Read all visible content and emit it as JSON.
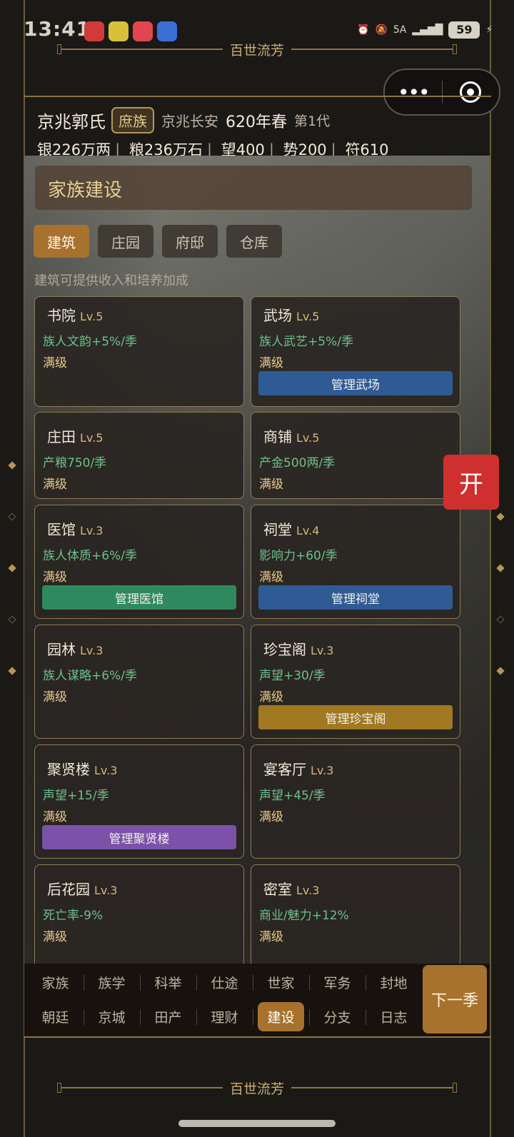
{
  "status_bar": {
    "time": "13:41",
    "network": "5A",
    "battery": "59"
  },
  "banner_text": "百世流芳",
  "capsule": {
    "menu_label": "•••"
  },
  "header": {
    "clan_name": "京兆郭氏",
    "clan_rank": "庶族",
    "location": "京兆长安",
    "year": "620年春",
    "generation": "第1代",
    "resources": [
      "银226万两",
      "粮236万石",
      "望400",
      "势200",
      "符610"
    ]
  },
  "section": {
    "title": "家族建设",
    "tabs": [
      "建筑",
      "庄园",
      "府邸",
      "仓库"
    ],
    "active_tab": "建筑",
    "hint": "建筑可提供收入和培养加成"
  },
  "buildings": [
    {
      "name": "书院",
      "level": "Lv.5",
      "effect": "族人文韵+5%/季",
      "status": "满级",
      "button": ""
    },
    {
      "name": "武场",
      "level": "Lv.5",
      "effect": "族人武艺+5%/季",
      "status": "满级",
      "button": "管理武场",
      "button_color": "#2f5b94"
    },
    {
      "name": "庄田",
      "level": "Lv.5",
      "effect": "产粮750/季",
      "status": "满级",
      "button": ""
    },
    {
      "name": "商铺",
      "level": "Lv.5",
      "effect": "产金500两/季",
      "status": "满级",
      "button": ""
    },
    {
      "name": "医馆",
      "level": "Lv.3",
      "effect": "族人体质+6%/季",
      "status": "满级",
      "button": "管理医馆",
      "button_color": "#2e8a5e"
    },
    {
      "name": "祠堂",
      "level": "Lv.4",
      "effect": "影响力+60/季",
      "status": "满级",
      "button": "管理祠堂",
      "button_color": "#2f5b94"
    },
    {
      "name": "园林",
      "level": "Lv.3",
      "effect": "族人谋略+6%/季",
      "status": "满级",
      "button": ""
    },
    {
      "name": "珍宝阁",
      "level": "Lv.3",
      "effect": "声望+30/季",
      "status": "满级",
      "button": "管理珍宝阁",
      "button_color": "#a07922"
    },
    {
      "name": "聚贤楼",
      "level": "Lv.3",
      "effect": "声望+15/季",
      "status": "满级",
      "button": "管理聚贤楼",
      "button_color": "#7b52a8"
    },
    {
      "name": "宴客厅",
      "level": "Lv.3",
      "effect": "声望+45/季",
      "status": "满级",
      "button": ""
    },
    {
      "name": "后花园",
      "level": "Lv.3",
      "effect": "死亡率-9%",
      "status": "满级",
      "button": ""
    },
    {
      "name": "密室",
      "level": "Lv.3",
      "effect": "商业/魅力+12%",
      "status": "满级",
      "button": ""
    }
  ],
  "fab_label": "开",
  "bottom_nav": {
    "row1": [
      "家族",
      "族学",
      "科举",
      "仕途",
      "世家",
      "军务",
      "封地"
    ],
    "row2": [
      "朝廷",
      "京城",
      "田产",
      "理财",
      "建设",
      "分支",
      "日志"
    ],
    "active": "建设",
    "next_button": "下一季"
  }
}
